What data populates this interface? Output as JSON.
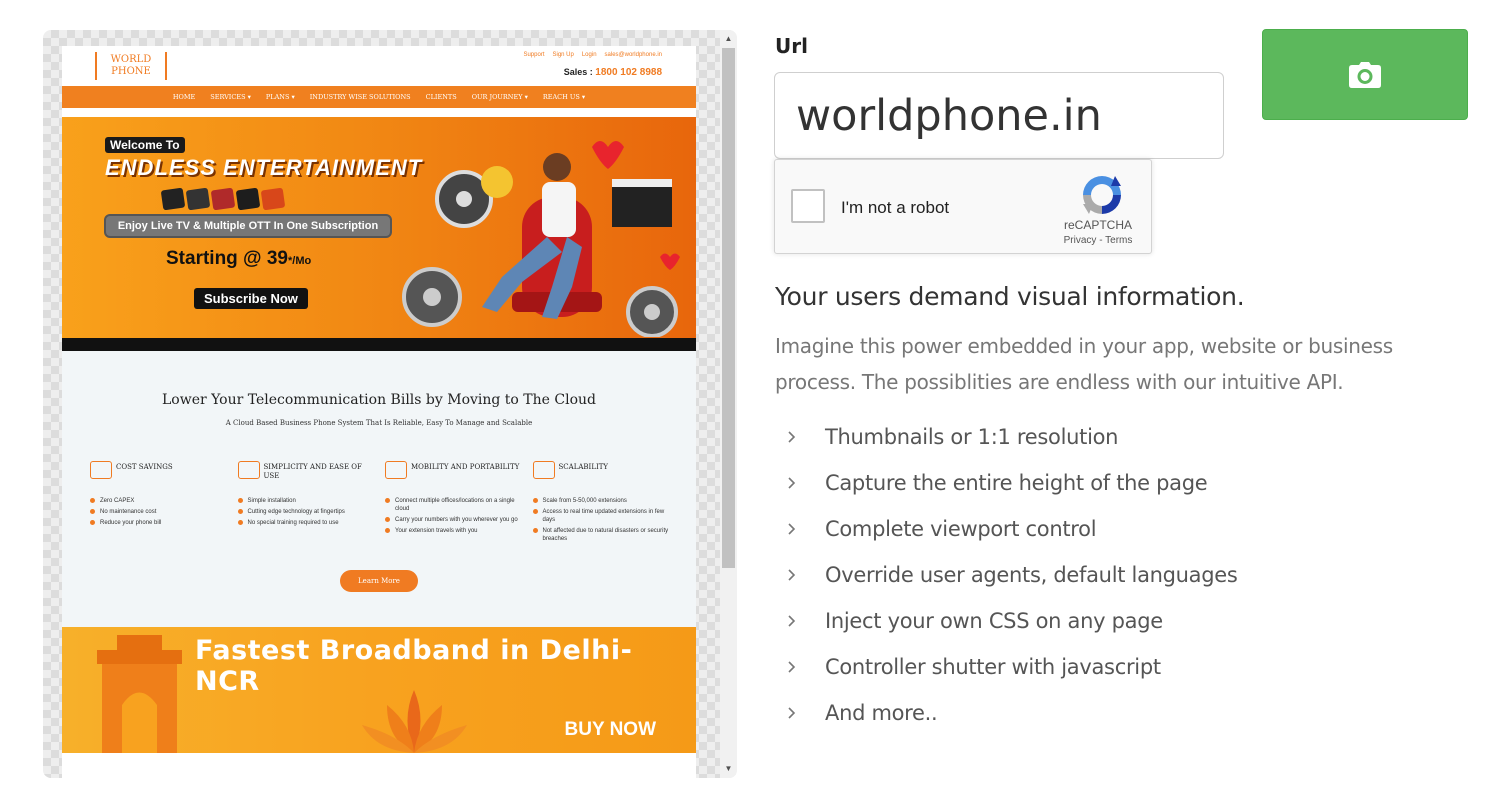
{
  "preview": {
    "site": {
      "logo_line1": "WORLD",
      "logo_line2": "PHONE",
      "top_links": [
        "Support",
        "Sign Up",
        "Login",
        "sales@worldphone.in"
      ],
      "sales_label": "Sales :",
      "sales_number": "1800 102 8988",
      "nav": [
        "HOME",
        "SERVICES ▾",
        "PLANS ▾",
        "INDUSTRY WISE SOLUTIONS",
        "CLIENTS",
        "OUR JOURNEY ▾",
        "REACH US ▾"
      ],
      "hero": {
        "welcome": "Welcome To",
        "title": "ENDLESS ENTERTAINMENT",
        "tagline": "Enjoy Live TV & Multiple OTT In One Subscription",
        "price": "Starting @ 39",
        "price_suffix": "*/Mo",
        "cta": "Subscribe Now"
      },
      "cloud": {
        "title": "Lower Your Telecommunication Bills by Moving to The Cloud",
        "subtitle": "A Cloud Based Business Phone System That Is Reliable, Easy To Manage and Scalable",
        "features": [
          {
            "title": "COST SAVINGS",
            "items": [
              "Zero CAPEX",
              "No maintenance cost",
              "Reduce your phone bill"
            ]
          },
          {
            "title": "SIMPLICITY AND EASE OF USE",
            "items": [
              "Simple installation",
              "Cutting edge technology at fingertips",
              "No special training required to use"
            ]
          },
          {
            "title": "MOBILITY AND PORTABILITY",
            "items": [
              "Connect multiple offices/locations on a single cloud",
              "Carry your numbers with you wherever you go",
              "Your extension travels with you"
            ]
          },
          {
            "title": "SCALABILITY",
            "items": [
              "Scale from 5-50,000 extensions",
              "Access to real time updated extensions in few days",
              "Not affected due to natural disasters or security breaches"
            ]
          }
        ],
        "learn_more": "Learn More"
      },
      "broadband": {
        "title": "Fastest Broadband in Delhi-NCR",
        "cta": "BUY NOW"
      }
    },
    "scroll_position": 0.0
  },
  "form": {
    "url_label": "Url",
    "url_value": "worldphone.in",
    "capture_icon": "camera-icon",
    "button_color": "#5cb85c"
  },
  "recaptcha": {
    "label": "I'm not a robot",
    "brand": "reCAPTCHA",
    "privacy": "Privacy",
    "separator": " - ",
    "terms": "Terms"
  },
  "marketing": {
    "headline": "Your users demand visual information.",
    "intro": "Imagine this power embedded in your app, website or business process. The possiblities are endless with our intuitive API.",
    "features": [
      "Thumbnails or 1:1 resolution",
      "Capture the entire height of the page",
      "Complete viewport control",
      "Override user agents, default languages",
      "Inject your own CSS on any page",
      "Controller shutter with javascript",
      "And more.."
    ]
  },
  "colors": {
    "brand_orange": "#f07b22",
    "success_green": "#5cb85c"
  }
}
